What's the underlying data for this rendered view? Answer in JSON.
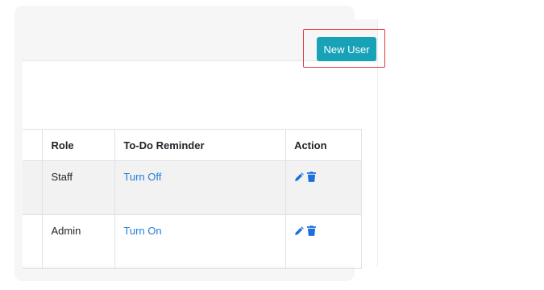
{
  "toolbar": {
    "new_user_label": "New User"
  },
  "table": {
    "headers": {
      "role": "Role",
      "reminder": "To-Do Reminder",
      "action": "Action"
    },
    "rows": [
      {
        "role": "Staff",
        "reminder": "Turn Off"
      },
      {
        "role": "Admin",
        "reminder": "Turn On"
      }
    ]
  },
  "colors": {
    "button": "#17a2b8",
    "link": "#1e7fd9",
    "icon": "#1d6fe0",
    "highlight": "#e03b3b"
  },
  "icons": {
    "edit": "pencil-icon",
    "delete": "trash-icon"
  }
}
